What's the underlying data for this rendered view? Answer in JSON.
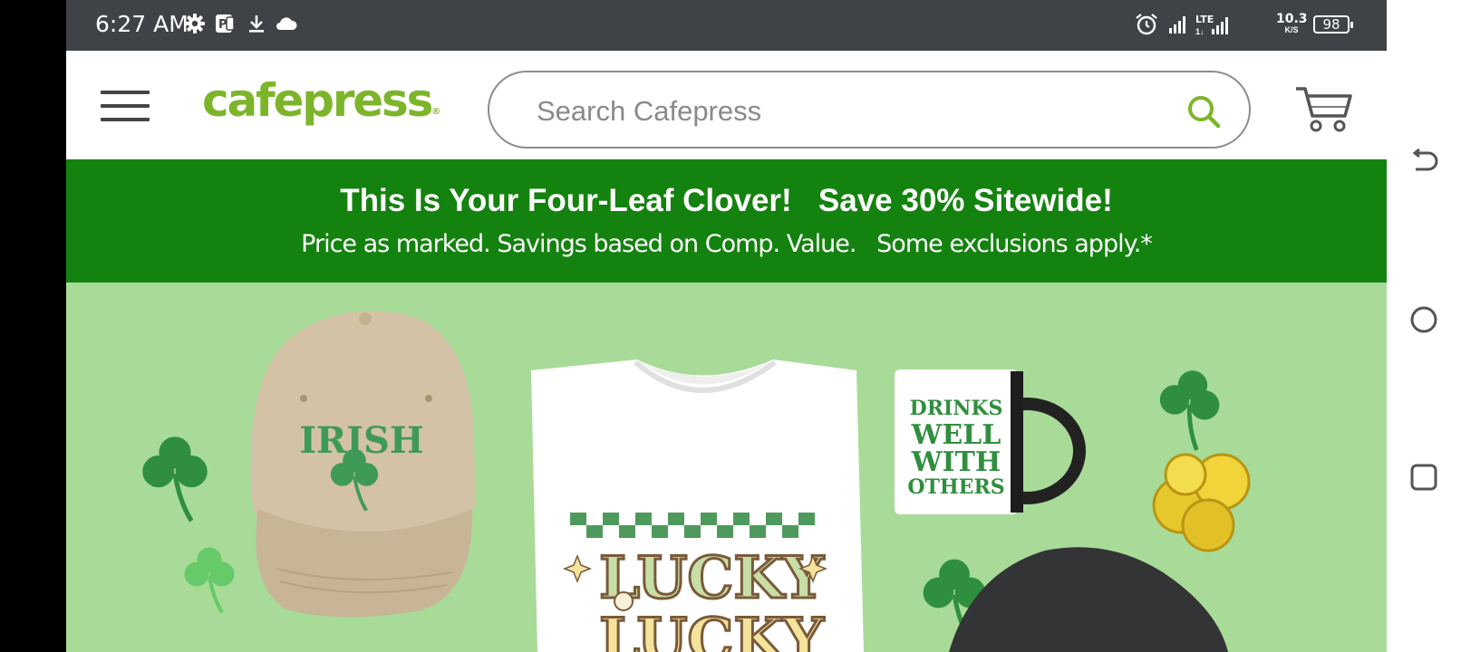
{
  "status_bar": {
    "time": "6:27 AM",
    "network_type": "LTE",
    "net_speed_value": "10.3",
    "net_speed_unit": "K/S",
    "battery": "98",
    "icons": [
      "settings-icon",
      "parking-app-icon",
      "download-icon",
      "cloud-icon",
      "alarm-icon",
      "signal-icon",
      "lte-signal-icon",
      "battery-icon"
    ]
  },
  "header": {
    "logo_text": "cafepress",
    "logo_mark": "®",
    "search_placeholder": "Search Cafepress",
    "icons": [
      "hamburger-menu-icon",
      "search-icon",
      "cart-icon"
    ]
  },
  "promo": {
    "headline": "This Is Your Four-Leaf Clover!   Save 30% Sitewide!",
    "subtext": "Price as marked. Savings based on Comp. Value.   Some exclusions apply.*"
  },
  "hero": {
    "cap_text": "IRISH",
    "mug_lines": [
      "DRINKS",
      "WELL",
      "WITH",
      "OTHERS"
    ],
    "shirt_text": [
      "LUCKY",
      "LUCKY"
    ],
    "colors": {
      "background": "#a8db98",
      "clover": "#2f8f3e",
      "cap": "#d3c2a6"
    }
  },
  "android_nav": {
    "icons": [
      "back-icon",
      "home-icon",
      "recents-icon"
    ]
  },
  "colors": {
    "brand_green": "#7db52a",
    "banner_green": "#14820f",
    "status_bar": "#3f4347"
  }
}
